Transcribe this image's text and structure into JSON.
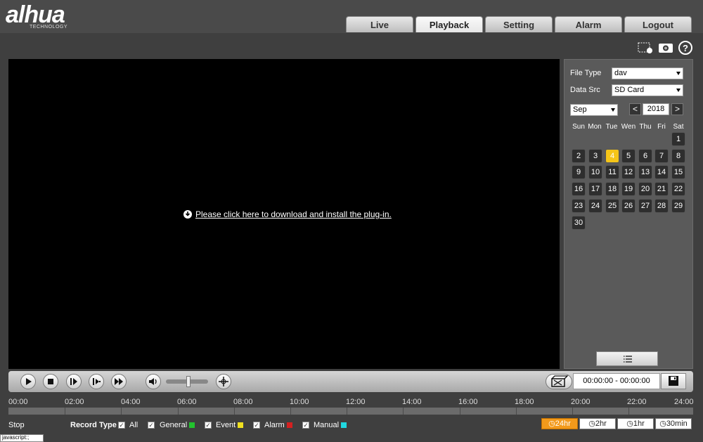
{
  "header": {
    "logo": "alhua",
    "logo_sub": "TECHNOLOGY",
    "tabs": [
      {
        "label": "Live"
      },
      {
        "label": "Playback"
      },
      {
        "label": "Setting"
      },
      {
        "label": "Alarm"
      },
      {
        "label": "Logout"
      }
    ],
    "active_tab": "Playback"
  },
  "toolbar_icons": [
    "fullscreen-icon",
    "snapshot-icon",
    "help-icon"
  ],
  "video": {
    "plugin_text": "Please click here to download and install the plug-in."
  },
  "panel": {
    "file_type_label": "File Type",
    "file_type_value": "dav",
    "data_src_label": "Data Src",
    "data_src_value": "SD Card",
    "month": "Sep",
    "year": "2018",
    "prev": "<",
    "next": ">",
    "weekdays": [
      "Sun",
      "Mon",
      "Tue",
      "Wen",
      "Thu",
      "Fri",
      "Sat"
    ],
    "days": [
      "1",
      "2",
      "3",
      "4",
      "5",
      "6",
      "7",
      "8",
      "9",
      "10",
      "11",
      "12",
      "13",
      "14",
      "15",
      "16",
      "17",
      "18",
      "19",
      "20",
      "21",
      "22",
      "23",
      "24",
      "25",
      "26",
      "27",
      "28",
      "29",
      "30"
    ],
    "selected_day": "4"
  },
  "controls": {
    "time_range": "00:00:00 - 00:00:00",
    "volume_level": 0.5
  },
  "timeline": {
    "labels": [
      "00:00",
      "02:00",
      "04:00",
      "06:00",
      "08:00",
      "10:00",
      "12:00",
      "14:00",
      "16:00",
      "18:00",
      "20:00",
      "22:00",
      "24:00"
    ]
  },
  "bottom": {
    "status": "Stop",
    "record_type_label": "Record Type",
    "types": [
      {
        "label": "All",
        "color": ""
      },
      {
        "label": "General",
        "color": "#22c32e"
      },
      {
        "label": "Event",
        "color": "#f0e020"
      },
      {
        "label": "Alarm",
        "color": "#d42020"
      },
      {
        "label": "Manual",
        "color": "#20d8e0"
      }
    ],
    "zoom": [
      "24hr",
      "2hr",
      "1hr",
      "30min"
    ],
    "zoom_active": "24hr",
    "status_tip": "javascript:;"
  }
}
